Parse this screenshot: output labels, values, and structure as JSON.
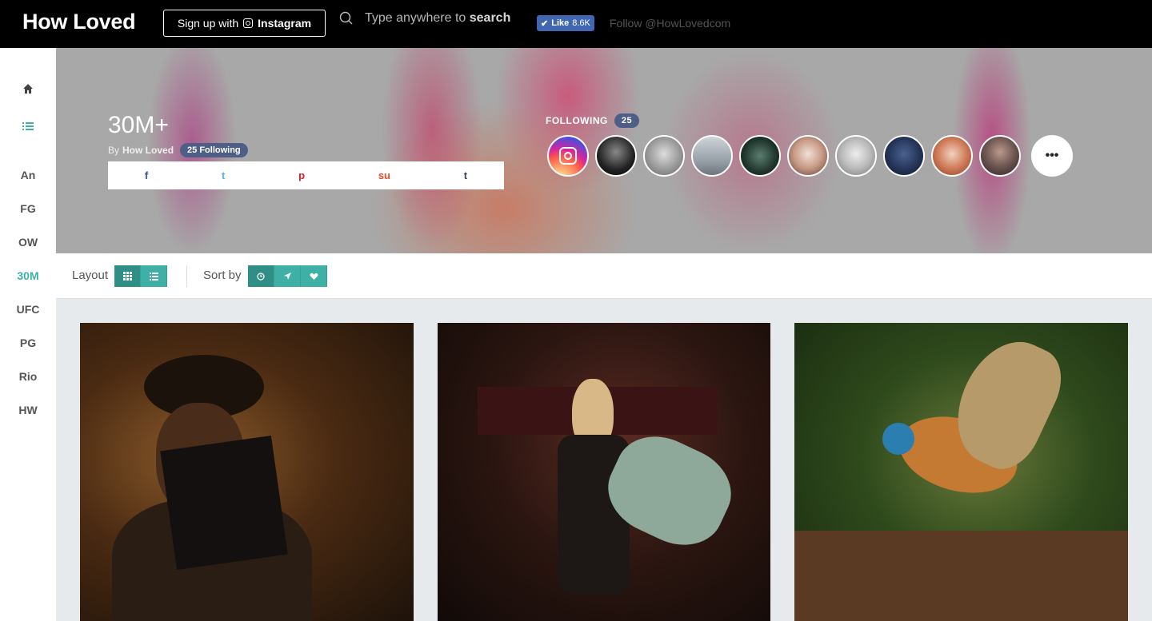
{
  "header": {
    "logo": "How Loved",
    "signup_prefix": "Sign up with",
    "signup_brand": "Instagram",
    "search_prefix": "Type anywhere to",
    "search_keyword": "search",
    "like_label": "Like",
    "like_count": "8.6K",
    "follow_text": "Follow @HowLovedcom"
  },
  "sidebar": {
    "items": [
      "An",
      "FG",
      "OW",
      "30M",
      "UFC",
      "PG",
      "Rio",
      "HW"
    ],
    "active": "30M"
  },
  "hero": {
    "title": "30M+",
    "by_prefix": "By",
    "author": "How Loved",
    "following_badge": "25 Following",
    "share": {
      "facebook": "f",
      "twitter": "t",
      "pinterest": "p",
      "stumbleupon": "su",
      "tumblr": "t"
    },
    "following_label": "FOLLOWING",
    "following_count": "25",
    "more": "•••"
  },
  "controls": {
    "layout_label": "Layout",
    "sort_label": "Sort by"
  },
  "colors": {
    "accent": "#3fb0a6",
    "badge": "#4d5f86",
    "facebook": "#3b5998",
    "twitter": "#55acee",
    "pinterest": "#cb2027",
    "stumbleupon": "#eb4924",
    "tumblr": "#35465c"
  }
}
